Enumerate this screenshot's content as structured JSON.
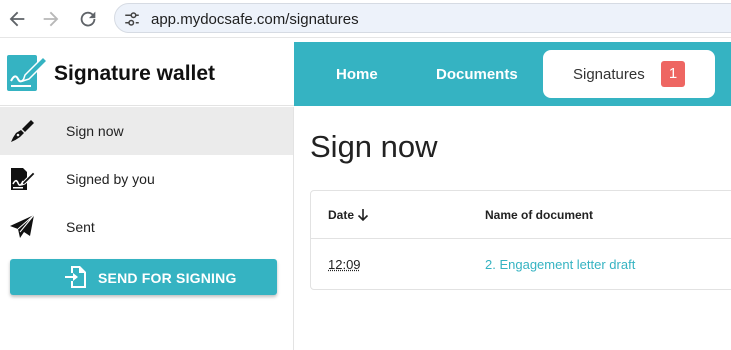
{
  "browser": {
    "url": "app.mydocsafe.com/signatures",
    "icons": [
      "back-arrow-icon",
      "forward-arrow-icon",
      "reload-icon",
      "site-settings-icon"
    ]
  },
  "brand": {
    "title": "Signature wallet",
    "logo_icon": "signature-document-icon"
  },
  "topnav": {
    "items": [
      {
        "label": "Home"
      },
      {
        "label": "Documents"
      },
      {
        "label": "Signatures",
        "badge": "1",
        "active": true
      }
    ]
  },
  "sidebar": {
    "items": [
      {
        "label": "Sign now",
        "icon": "pen-nib-icon",
        "active": true
      },
      {
        "label": "Signed by you",
        "icon": "signed-document-icon"
      },
      {
        "label": "Sent",
        "icon": "paper-plane-icon"
      }
    ],
    "send_button": {
      "label": "SEND FOR SIGNING",
      "icon": "file-import-icon"
    }
  },
  "main": {
    "title": "Sign now",
    "table": {
      "columns": [
        "Date",
        "Name of document"
      ],
      "sort_icon": "arrow-down-icon",
      "rows": [
        {
          "date": "12:09",
          "name": "2. Engagement letter draft"
        }
      ]
    }
  },
  "colors": {
    "accent": "#35b3c2",
    "badge": "#ee6662",
    "active_sidebar": "#ebebeb"
  }
}
